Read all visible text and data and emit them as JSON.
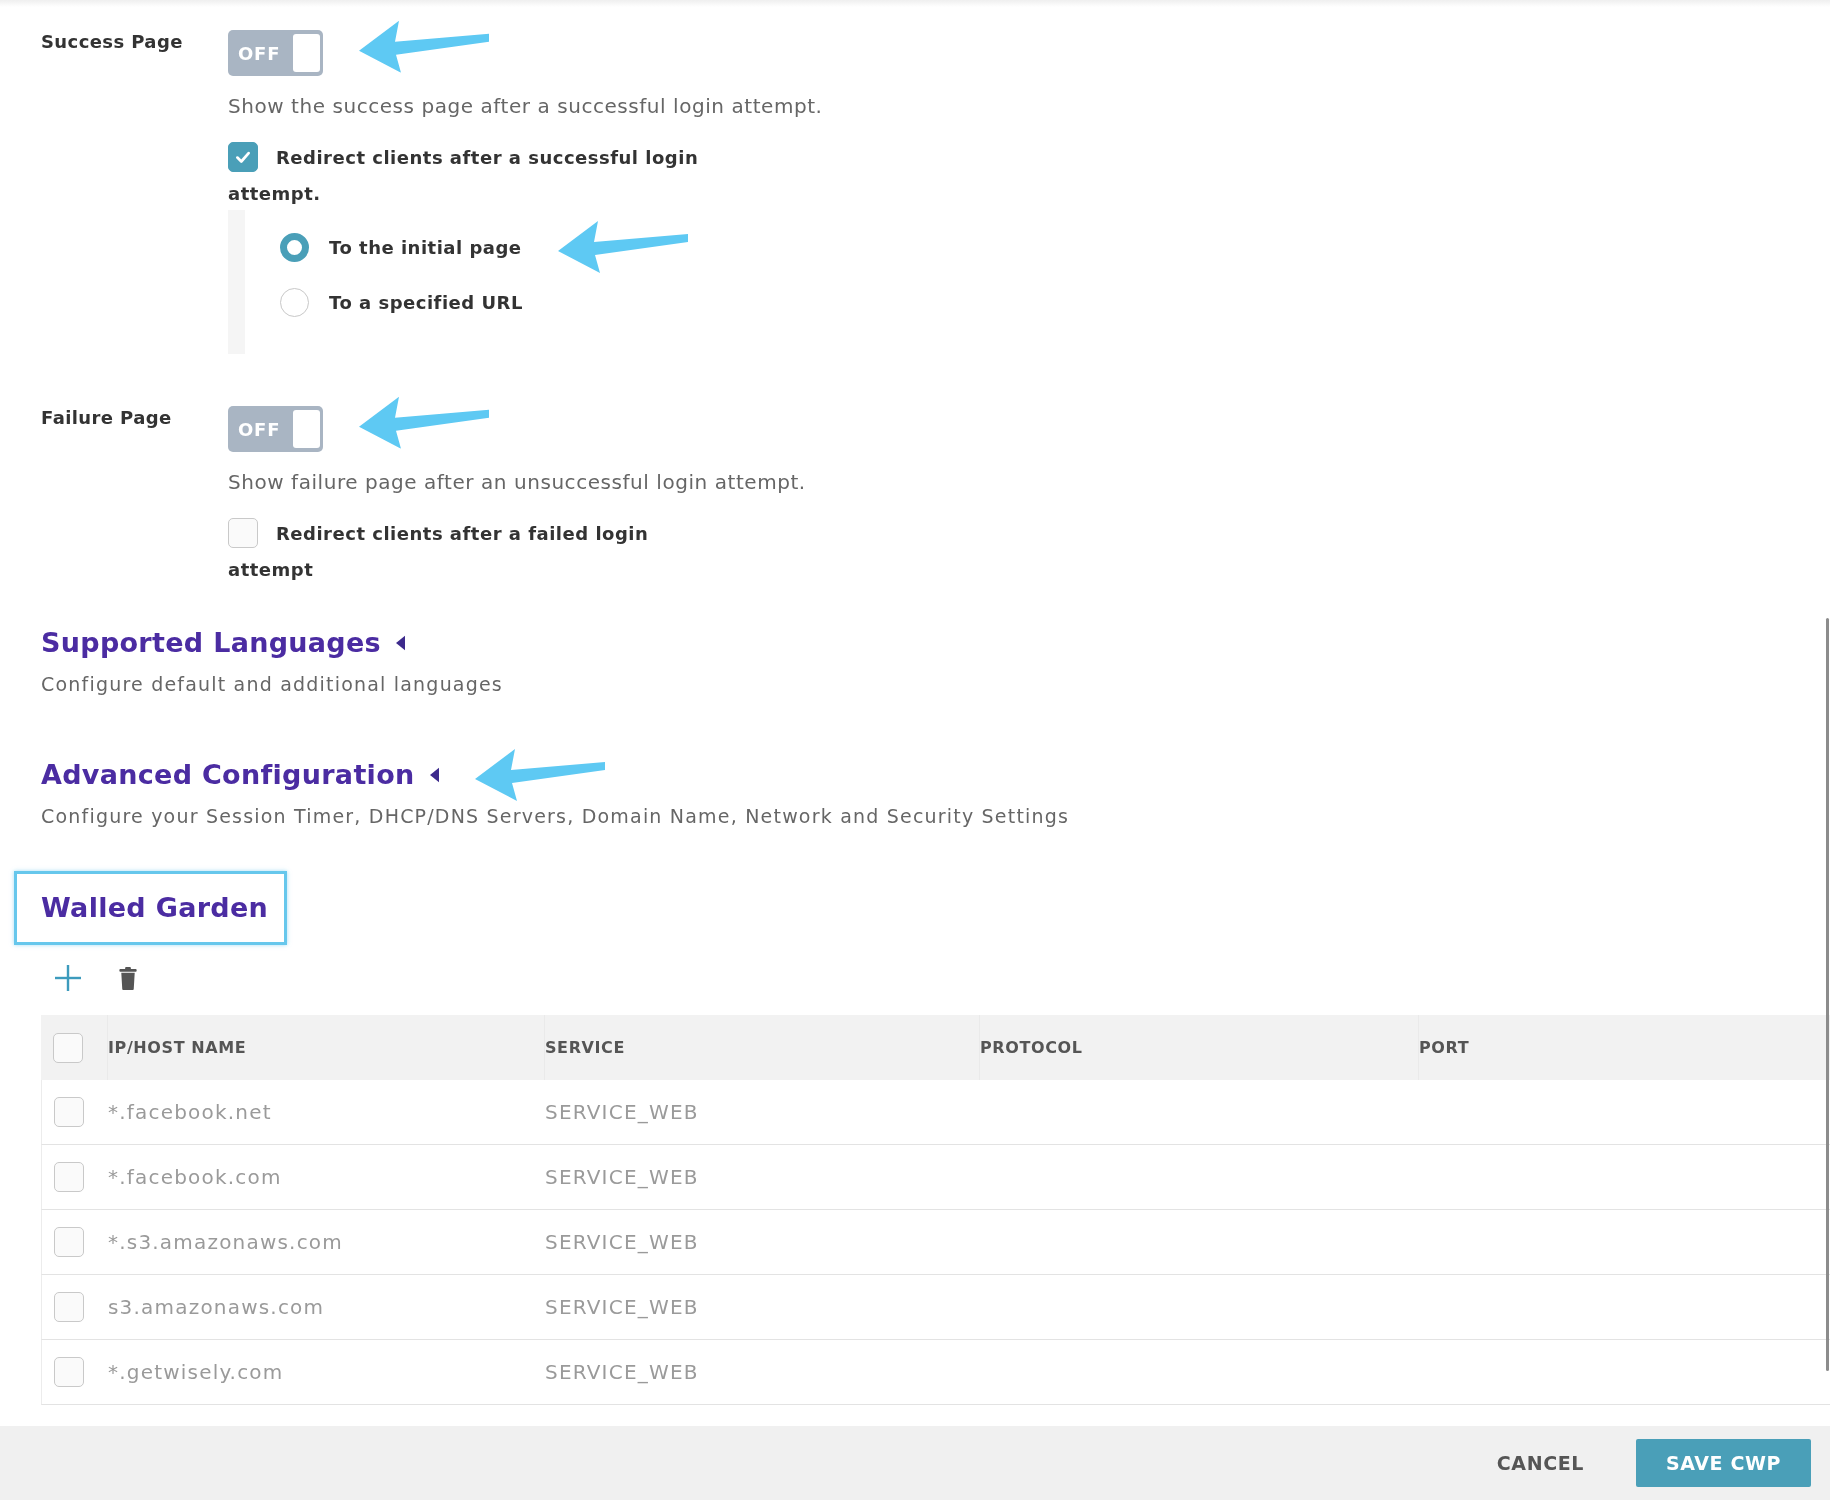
{
  "settings": [
    {
      "label": "Success Page",
      "toggle": {
        "text": "OFF",
        "on": false,
        "callout": true
      },
      "help": "Show the success page after a successful login attempt.",
      "redirect": {
        "label": "Redirect clients after a successful login attempt.",
        "checked": true
      },
      "options": [
        {
          "label": "To the initial page",
          "selected": true,
          "callout": true
        },
        {
          "label": "To a specified URL",
          "selected": false,
          "callout": false
        }
      ]
    },
    {
      "label": "Failure Page",
      "toggle": {
        "text": "OFF",
        "on": false,
        "callout": true
      },
      "help": "Show failure page after an unsuccessful login attempt.",
      "redirect": {
        "label": "Redirect clients after a failed login attempt",
        "checked": false
      }
    }
  ],
  "collapsibles": [
    {
      "title": "Supported Languages",
      "expanded": false,
      "callout": false,
      "description": "Configure default and additional languages"
    },
    {
      "title": "Advanced Configuration",
      "expanded": false,
      "callout": true,
      "description": "Configure your Session Timer, DHCP/DNS Servers, Domain Name, Network and Security Settings"
    }
  ],
  "walled_garden": {
    "title": "Walled Garden",
    "highlighted": true,
    "toolbar": [
      {
        "kind": "add"
      },
      {
        "kind": "delete"
      }
    ],
    "table": {
      "select_all": {
        "checked": false
      },
      "columns": [
        "IP/HOST NAME",
        "SERVICE",
        "PROTOCOL",
        "PORT"
      ],
      "rows": [
        {
          "checked": false,
          "host": "*.facebook.net",
          "service": "SERVICE_WEB"
        },
        {
          "checked": false,
          "host": "*.facebook.com",
          "service": "SERVICE_WEB"
        },
        {
          "checked": false,
          "host": "*.s3.amazonaws.com",
          "service": "SERVICE_WEB"
        },
        {
          "checked": false,
          "host": "s3.amazonaws.com",
          "service": "SERVICE_WEB"
        },
        {
          "checked": false,
          "host": "*.getwisely.com",
          "service": "SERVICE_WEB"
        }
      ]
    }
  },
  "footer": {
    "buttons": [
      {
        "kind": "secondary",
        "label": "CANCEL"
      },
      {
        "kind": "primary",
        "label": "SAVE CWP"
      }
    ]
  }
}
